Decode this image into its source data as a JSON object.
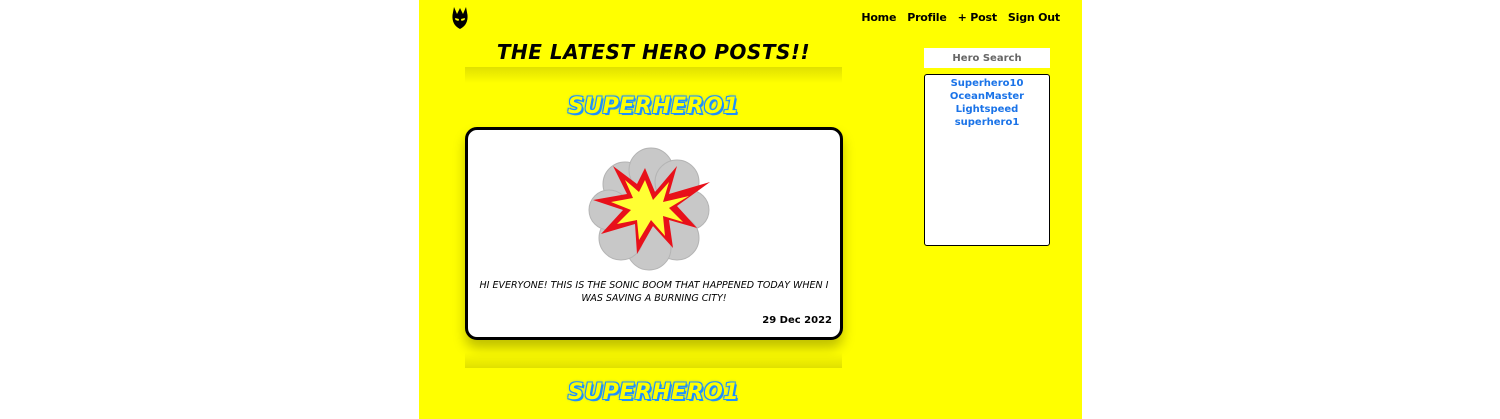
{
  "nav": {
    "items": [
      {
        "label": "Home"
      },
      {
        "label": "Profile"
      },
      {
        "label": "+ Post"
      },
      {
        "label": "Sign Out"
      }
    ]
  },
  "feed": {
    "title": "The Latest Hero Posts!!",
    "posts": [
      {
        "author": "superhero1",
        "image_icon": "comic-explosion-icon",
        "text": "Hi everyone! This is the sonic boom that happened today when I was saving a burning city!",
        "date": "29 Dec 2022"
      },
      {
        "author": "superhero1"
      }
    ]
  },
  "sidebar": {
    "search_placeholder": "Hero Search",
    "heroes": [
      "Superhero10",
      "OceanMaster",
      "Lightspeed",
      "superhero1"
    ]
  },
  "colors": {
    "background": "#ffff00",
    "link": "#1a73e8",
    "author_outline": "#1e90ff"
  }
}
